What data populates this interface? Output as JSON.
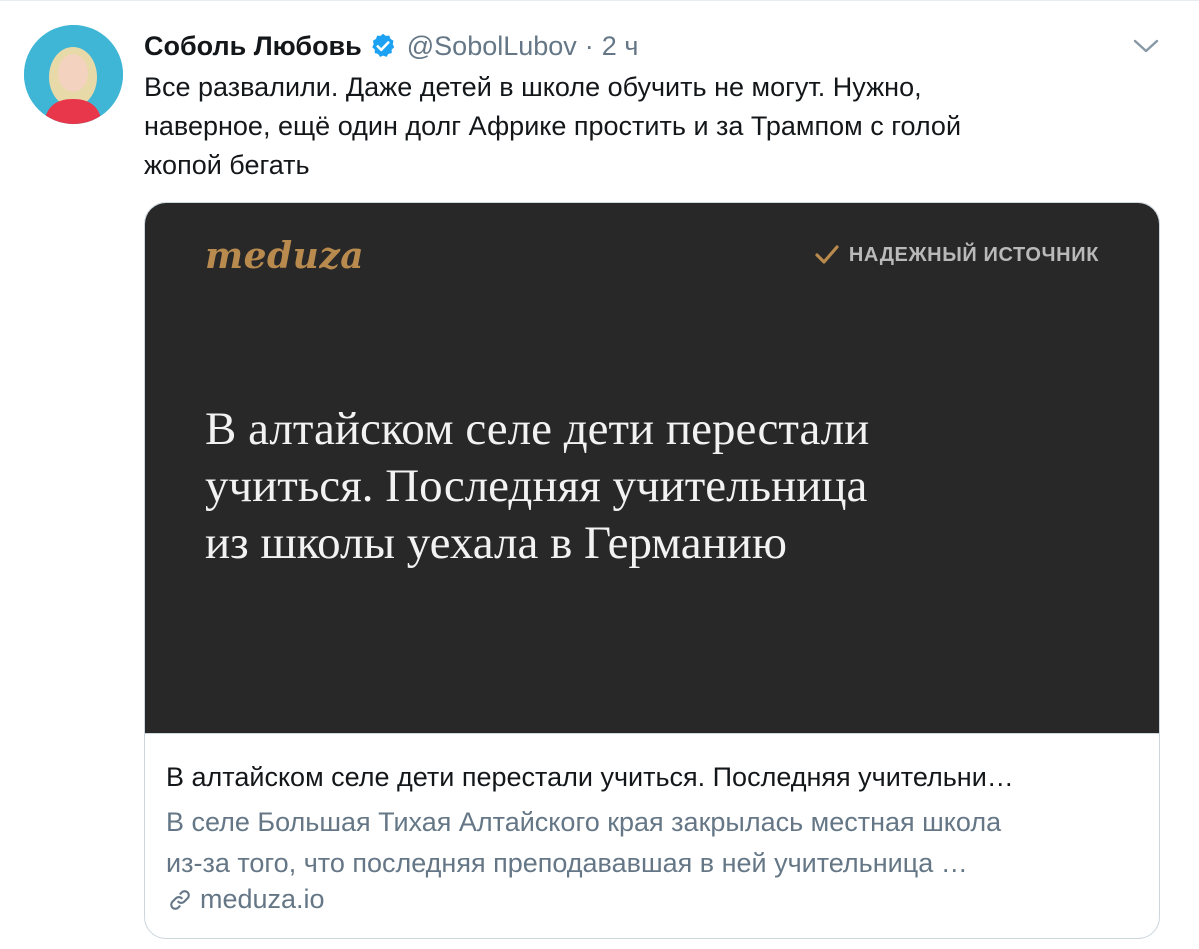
{
  "author": {
    "display_name": "Соболь Любовь",
    "handle": "@SobolLubov",
    "separator": "·",
    "time": "2 ч",
    "verified": true
  },
  "tweet": {
    "text_lines": [
      "Все развалили. Даже детей в школе обучить не могут. Нужно,",
      "наверное, ещё один долг Африке простить и за Трампом с голой",
      "жопой бегать"
    ]
  },
  "card": {
    "image": {
      "logo_text": "meduza",
      "trusted_label": "НАДЕЖНЫЙ ИСТОЧНИК",
      "headline_lines": [
        "В алтайском селе дети перестали",
        "учиться. Последняя учительница",
        "из школы уехала в Германию"
      ]
    },
    "title": "В алтайском селе дети перестали учиться. Последняя учительни…",
    "description_lines": [
      "В селе Большая Тихая Алтайского края закрылась местная школа",
      "из-за того, что последняя преподававшая в ней учительница …"
    ],
    "domain": "meduza.io"
  },
  "colors": {
    "verified_blue": "#1da1f2",
    "meduza_gold": "#b88a4e",
    "card_dark": "#282828",
    "secondary_text": "#657786"
  },
  "icons": {
    "verified": "verified-badge-icon",
    "caret": "chevron-down-icon",
    "check": "check-icon",
    "link": "link-icon"
  }
}
